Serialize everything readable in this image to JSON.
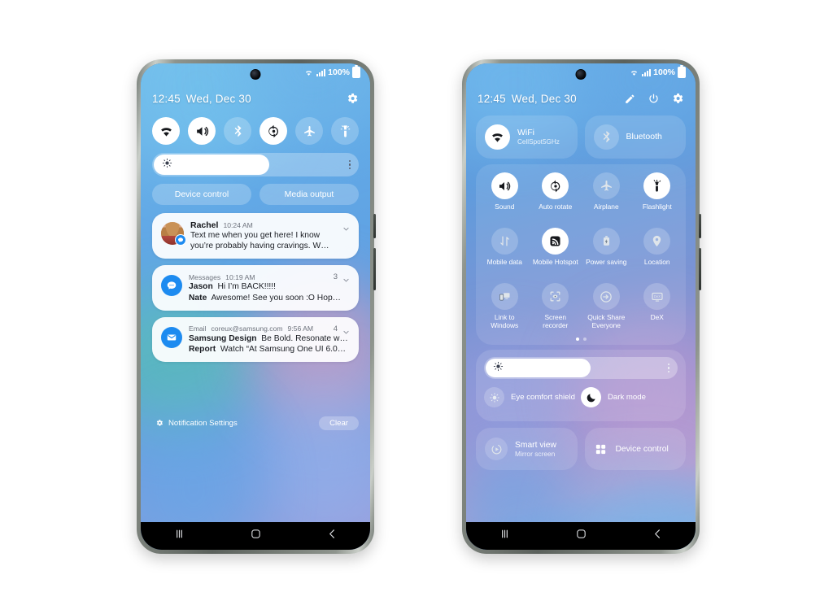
{
  "status_bar": {
    "battery_text": "100%",
    "wifi_icon": "wifi-icon",
    "signal_icon": "signal-bars-icon",
    "battery_icon": "battery-full-icon"
  },
  "left_phone": {
    "header": {
      "time": "12:45",
      "date": "Wed, Dec 30",
      "settings_icon": "gear-icon"
    },
    "quick_toggles": [
      {
        "name": "wifi",
        "icon": "wifi-icon",
        "state": "on"
      },
      {
        "name": "sound",
        "icon": "sound-icon",
        "state": "on"
      },
      {
        "name": "bluetooth",
        "icon": "bluetooth-icon",
        "state": "off"
      },
      {
        "name": "auto-rotate",
        "icon": "auto-rotate-icon",
        "state": "on"
      },
      {
        "name": "airplane",
        "icon": "airplane-icon",
        "state": "off"
      },
      {
        "name": "flashlight",
        "icon": "flashlight-icon",
        "state": "off"
      }
    ],
    "brightness": {
      "icon": "brightness-icon",
      "value": 56,
      "more_icon": "kebab-menu-icon"
    },
    "buttons": [
      {
        "label": "Device control"
      },
      {
        "label": "Media output"
      }
    ],
    "notifications": [
      {
        "sender": "Rachel",
        "time": "10:24 AM",
        "count": "",
        "avatar": "contact-photo",
        "lines": [
          {
            "bold": "",
            "text": "Text me when you get here! I know"
          },
          {
            "bold": "",
            "text": "you’re probably having cravings. W…"
          }
        ]
      },
      {
        "sender": "Messages",
        "time": "10:19 AM",
        "count": "3",
        "avatar": "messages-icon",
        "lines": [
          {
            "bold": "Jason",
            "text": "Hi I’m BACK!!!!!"
          },
          {
            "bold": "Nate",
            "text": "Awesome! See you soon :O Hop…"
          }
        ]
      },
      {
        "sender": "Email",
        "address": "coreux@samsung.com",
        "time": "9:56 AM",
        "count": "4",
        "avatar": "email-icon",
        "lines": [
          {
            "bold": "Samsung Design",
            "text": "Be Bold. Resonate w…"
          },
          {
            "bold": "Report",
            "text": "Watch “At Samsung One UI 6.0…"
          }
        ]
      }
    ],
    "footer": {
      "settings_label": "Notification Settings",
      "settings_icon": "gear-icon",
      "clear_label": "Clear"
    }
  },
  "right_phone": {
    "header": {
      "time": "12:45",
      "date": "Wed, Dec 30",
      "edit_icon": "pencil-icon",
      "power_icon": "power-icon",
      "settings_icon": "gear-icon"
    },
    "connectivity": [
      {
        "title": "WiFi",
        "subtitle": "CellSpot5GHz",
        "icon": "wifi-icon",
        "state": "on"
      },
      {
        "title": "Bluetooth",
        "subtitle": "",
        "icon": "bluetooth-icon",
        "state": "off"
      }
    ],
    "tiles": [
      {
        "label": "Sound",
        "icon": "sound-icon",
        "state": "on"
      },
      {
        "label": "Auto rotate",
        "icon": "auto-rotate-icon",
        "state": "on"
      },
      {
        "label": "Airplane",
        "icon": "airplane-icon",
        "state": "off"
      },
      {
        "label": "Flashlight",
        "icon": "flashlight-icon",
        "state": "on"
      },
      {
        "label": "Mobile data",
        "icon": "mobile-data-icon",
        "state": "off"
      },
      {
        "label": "Mobile Hotspot",
        "icon": "hotspot-icon",
        "state": "on"
      },
      {
        "label": "Power saving",
        "icon": "battery-saver-icon",
        "state": "off"
      },
      {
        "label": "Location",
        "icon": "location-pin-icon",
        "state": "off"
      },
      {
        "label": "Link to Windows",
        "icon": "link-to-windows-icon",
        "state": "off"
      },
      {
        "label": "Screen recorder",
        "icon": "screen-recorder-icon",
        "state": "off"
      },
      {
        "label": "Quick Share Everyone",
        "icon": "quick-share-icon",
        "state": "off"
      },
      {
        "label": "DeX",
        "icon": "dex-icon",
        "state": "off"
      }
    ],
    "pages": {
      "total": 2,
      "active": 1
    },
    "brightness": {
      "icon": "brightness-icon",
      "value": 54,
      "more_icon": "kebab-menu-icon"
    },
    "modes": [
      {
        "label": "Eye comfort shield",
        "icon": "eye-comfort-icon",
        "state": "off"
      },
      {
        "label": "Dark mode",
        "icon": "moon-icon",
        "state": "on"
      }
    ],
    "bottom": [
      {
        "title": "Smart view",
        "subtitle": "Mirror screen",
        "icon": "smart-view-icon"
      },
      {
        "title": "Device control",
        "subtitle": "",
        "icon": "device-control-icon"
      }
    ]
  },
  "nav_bar": {
    "recents_icon": "recents-icon",
    "home_icon": "home-icon",
    "back_icon": "back-icon"
  },
  "colors": {
    "accent_blue": "#1d8bf0",
    "frame": "#8e948d",
    "wallpaper_base": "#5aa7e8"
  }
}
